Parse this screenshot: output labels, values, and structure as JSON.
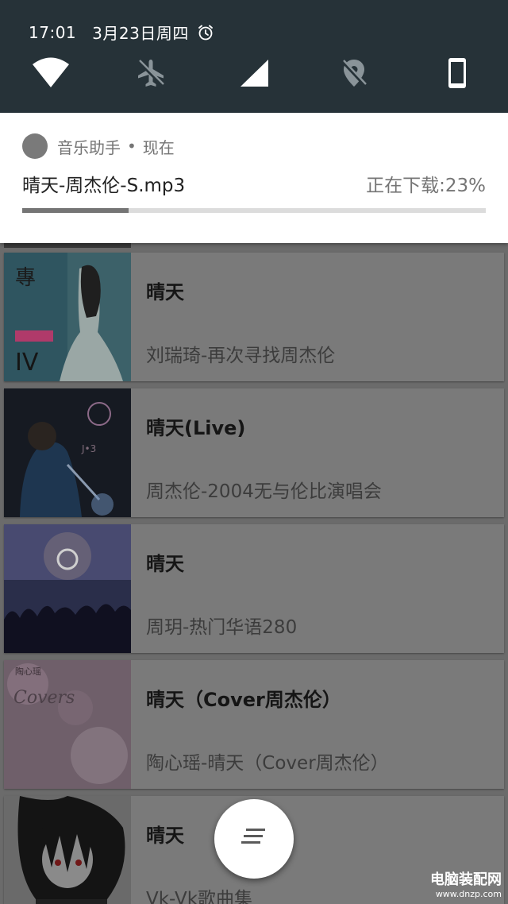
{
  "status_bar": {
    "time": "17:01",
    "date": "3月23日周四",
    "alarm_icon": "alarm-clock-icon"
  },
  "quick_settings": [
    {
      "icon": "wifi-icon",
      "state": "on"
    },
    {
      "icon": "airplane-mode-icon",
      "state": "off"
    },
    {
      "icon": "cellular-signal-icon",
      "state": "on"
    },
    {
      "icon": "location-off-icon",
      "state": "off"
    },
    {
      "icon": "phone-rotation-icon",
      "state": "on"
    }
  ],
  "notification": {
    "app_name": "音乐助手",
    "separator": "•",
    "when": "现在",
    "title": "晴天-周杰伦-S.mp3",
    "status": "正在下载:23%",
    "progress": 0.23
  },
  "songs": [
    {
      "title": "晴天",
      "subtitle": "刘瑞琦-再次寻找周杰伦"
    },
    {
      "title": "晴天(Live)",
      "subtitle": "周杰伦-2004无与伦比演唱会"
    },
    {
      "title": "晴天",
      "subtitle": "周玥-热门华语280"
    },
    {
      "title": "晴天（Cover周杰伦）",
      "subtitle": "陶心瑶-晴天（Cover周杰伦）"
    },
    {
      "title": "晴天",
      "subtitle": "Vk-Vk歌曲集"
    }
  ],
  "fab": {
    "icon": "playlist-icon"
  },
  "watermark": {
    "line1": "电脑装配网",
    "line2": "www.dnzp.com"
  },
  "colors": {
    "shade_bg": "#263238",
    "progress_fill": "#757575",
    "progress_track": "#dcdcdc"
  }
}
